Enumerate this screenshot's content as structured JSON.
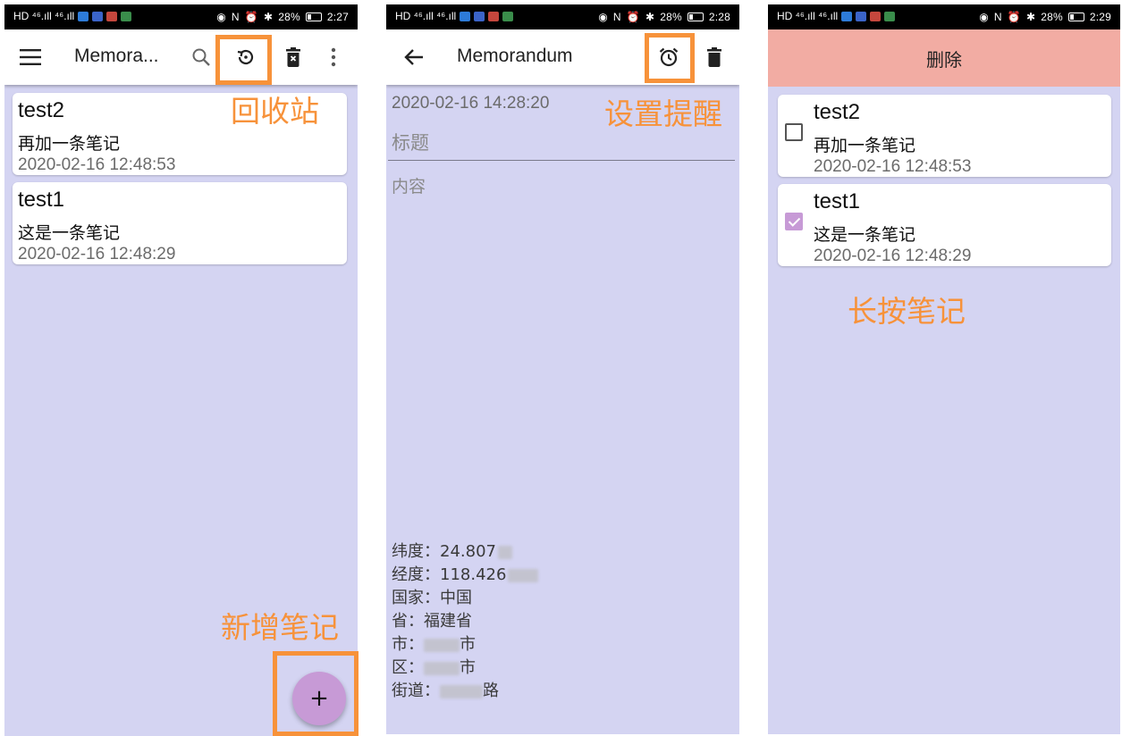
{
  "status_bars": [
    {
      "left": "HD ⁴⁶.ıll ⁴⁶.ıll",
      "right": "28%",
      "time": "2:27"
    },
    {
      "left": "HD ⁴⁶.ıll ⁴⁶.ıll",
      "right": "28%",
      "time": "2:28"
    },
    {
      "left": "HD ⁴⁶.ıll ⁴⁶.ıll",
      "right": "28%",
      "time": "2:29"
    }
  ],
  "list_screen": {
    "title": "Memora...",
    "icons": [
      "menu-icon",
      "search-icon",
      "restore-icon",
      "delete-forever-icon",
      "more-vert-icon"
    ],
    "notes": [
      {
        "title": "test2",
        "body": "再加一条笔记",
        "time": "2020-02-16 12:48:53"
      },
      {
        "title": "test1",
        "body": "这是一条笔记",
        "time": "2020-02-16 12:48:29"
      }
    ],
    "fab_label": "+",
    "annotations": {
      "recycle": "回收站",
      "add": "新增笔记"
    }
  },
  "edit_screen": {
    "title": "Memorandum",
    "icons": [
      "back-arrow-icon",
      "alarm-icon",
      "delete-icon"
    ],
    "date": "2020-02-16 14:28:20",
    "title_placeholder": "标题",
    "content_placeholder": "内容",
    "location": {
      "lat_label": "纬度：",
      "lat_value": "24.807",
      "lng_label": "经度：",
      "lng_value": "118.426",
      "country_label": "国家：",
      "country_value": "中国",
      "province_label": "省：",
      "province_value": "福建省",
      "city_label": "市：",
      "city_suffix": "市",
      "district_label": "区：",
      "district_suffix": "市",
      "street_label": "街道：",
      "street_suffix": "路"
    },
    "annotation": "设置提醒"
  },
  "select_screen": {
    "delete_label": "删除",
    "notes": [
      {
        "title": "test2",
        "body": "再加一条笔记",
        "time": "2020-02-16 12:48:53",
        "checked": false
      },
      {
        "title": "test1",
        "body": "这是一条笔记",
        "time": "2020-02-16 12:48:29",
        "checked": true
      }
    ],
    "annotation": "长按笔记"
  },
  "colors": {
    "background": "#d4d4f2",
    "annotation": "#f7923a",
    "fab": "#c79ad6",
    "delete_bar": "#f2aca3"
  }
}
